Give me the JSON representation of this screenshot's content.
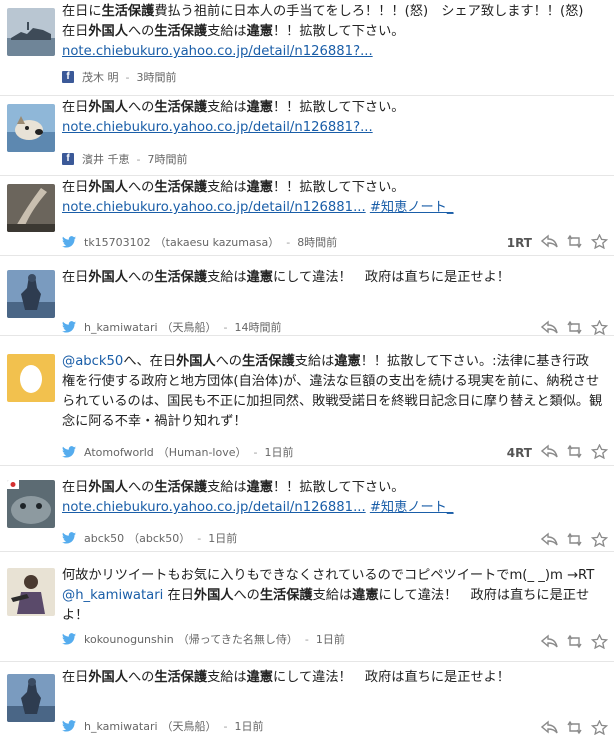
{
  "icons": {
    "facebook": "facebook-icon",
    "twitter": "twitter-icon",
    "reply": "reply-icon",
    "retweet": "retweet-icon",
    "favorite": "star-icon"
  },
  "colors": {
    "link": "#1a5ea8",
    "facebook": "#3b5998",
    "twitter": "#55acee"
  },
  "posts": [
    {
      "text_a": "在日に",
      "text_b": "生活保護",
      "text_c": "費払う祖前に日本人の手当てをしろ！！！(怒)　シェア致します！！(怒)",
      "line2_a": "在日",
      "line2_b": "外国人",
      "line2_c": "への",
      "line2_d": "生活保護",
      "line2_e": "支給は",
      "line2_f": "違憲",
      "line2_g": "！！拡散して下さい。",
      "link": "note.chiebukuro.yahoo.co.jp/detail/n126881?...",
      "author": "茂木 明",
      "time": "3時間前",
      "source": "facebook"
    },
    {
      "a": "在日",
      "b": "外国人",
      "c": "への",
      "d": "生活保護",
      "e": "支給は",
      "f": "違憲",
      "g": "！！拡散して下さい。",
      "link": "note.chiebukuro.yahoo.co.jp/detail/n126881?...",
      "author": "濱井 千恵",
      "time": "7時間前",
      "source": "facebook"
    },
    {
      "a": "在日",
      "b": "外国人",
      "c": "への",
      "d": "生活保護",
      "e": "支給は",
      "f": "違憲",
      "g": "！！拡散して下さい。",
      "link": "note.chiebukuro.yahoo.co.jp/detail/n126881...",
      "tag": "#知恵ノート_",
      "author": "tk15703102",
      "author_name": "（takaesu kazumasa）",
      "time": "8時間前",
      "rt": "1RT",
      "source": "twitter"
    },
    {
      "a": "在日",
      "b": "外国人",
      "c": "への",
      "d": "生活保護",
      "e": "支給は",
      "f": "違憲",
      "g": "にして違法！　政府は直ちに是正せよ！",
      "author": "h_kamiwatari",
      "author_name": "（天鳥船）",
      "time": "14時間前",
      "source": "twitter"
    },
    {
      "mention": "@abck50",
      "a": "へ、在日",
      "b": "外国人",
      "c": "への",
      "d": "生活保護",
      "e": "支給は",
      "f": "違憲",
      "g": "！！拡散して下さい。:法律に基き行政",
      "line2": "権を行使する政府と地方団体(自治体)が、違法な巨額の支出を続ける現実を前に、納税させ",
      "line3": "られているのは、国民も不正に加担同然、敗戦受諾日を終戦日記念日に摩り替えと類似。観",
      "line4": "念に阿る不幸・禍計り知れず！",
      "author": "Atomofworld",
      "author_name": "（Human-love）",
      "time": "1日前",
      "rt": "4RT",
      "source": "twitter"
    },
    {
      "a": "在日",
      "b": "外国人",
      "c": "への",
      "d": "生活保護",
      "e": "支給は",
      "f": "違憲",
      "g": "！！拡散して下さい。",
      "link": "note.chiebukuro.yahoo.co.jp/detail/n126881...",
      "tag": "#知恵ノート_",
      "author": "abck50",
      "author_name": "（abck50）",
      "time": "1日前",
      "source": "twitter"
    },
    {
      "line1": "何故かリツイートもお気に入りもできなくされているのでコピペツイートでm(_ _)m →RT",
      "mention": "@h_kamiwatari",
      "a": " 在日",
      "b": "外国人",
      "c": "への",
      "d": "生活保護",
      "e": "支給は",
      "f": "違憲",
      "g": "にして違法！　政府は直ちに是正せ",
      "line3": "よ！",
      "author": "kokounogunshin",
      "author_name": "（帰ってきた名無し侍）",
      "time": "1日前",
      "source": "twitter"
    },
    {
      "a": "在日",
      "b": "外国人",
      "c": "への",
      "d": "生活保護",
      "e": "支給は",
      "f": "違憲",
      "g": "にして違法！　政府は直ちに是正せよ！",
      "author": "h_kamiwatari",
      "author_name": "（天鳥船）",
      "time": "1日前",
      "source": "twitter"
    }
  ]
}
